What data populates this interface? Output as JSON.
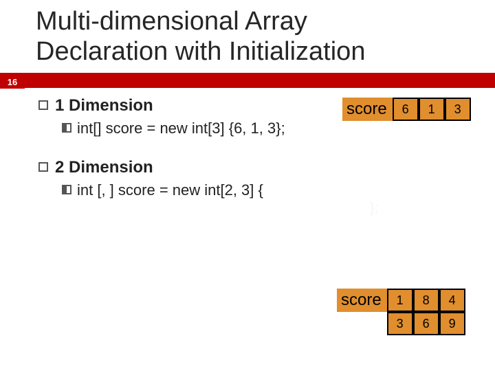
{
  "pageNumber": "16",
  "title_line1": "Multi-dimensional Array",
  "title_line2": "Declaration with Initialization",
  "dim1": {
    "heading": "1 Dimension",
    "code": "int[] score = new int[3] {6, 1, 3};",
    "label": "score",
    "values": [
      "6",
      "1",
      "3"
    ]
  },
  "dim2": {
    "heading": "2 Dimension",
    "code": "int [, ] score = new int[2, 3] {",
    "label": "score",
    "rows": [
      [
        "1",
        "8",
        "4"
      ],
      [
        "3",
        "6",
        "9"
      ]
    ]
  },
  "hiddenGlyph": "};"
}
